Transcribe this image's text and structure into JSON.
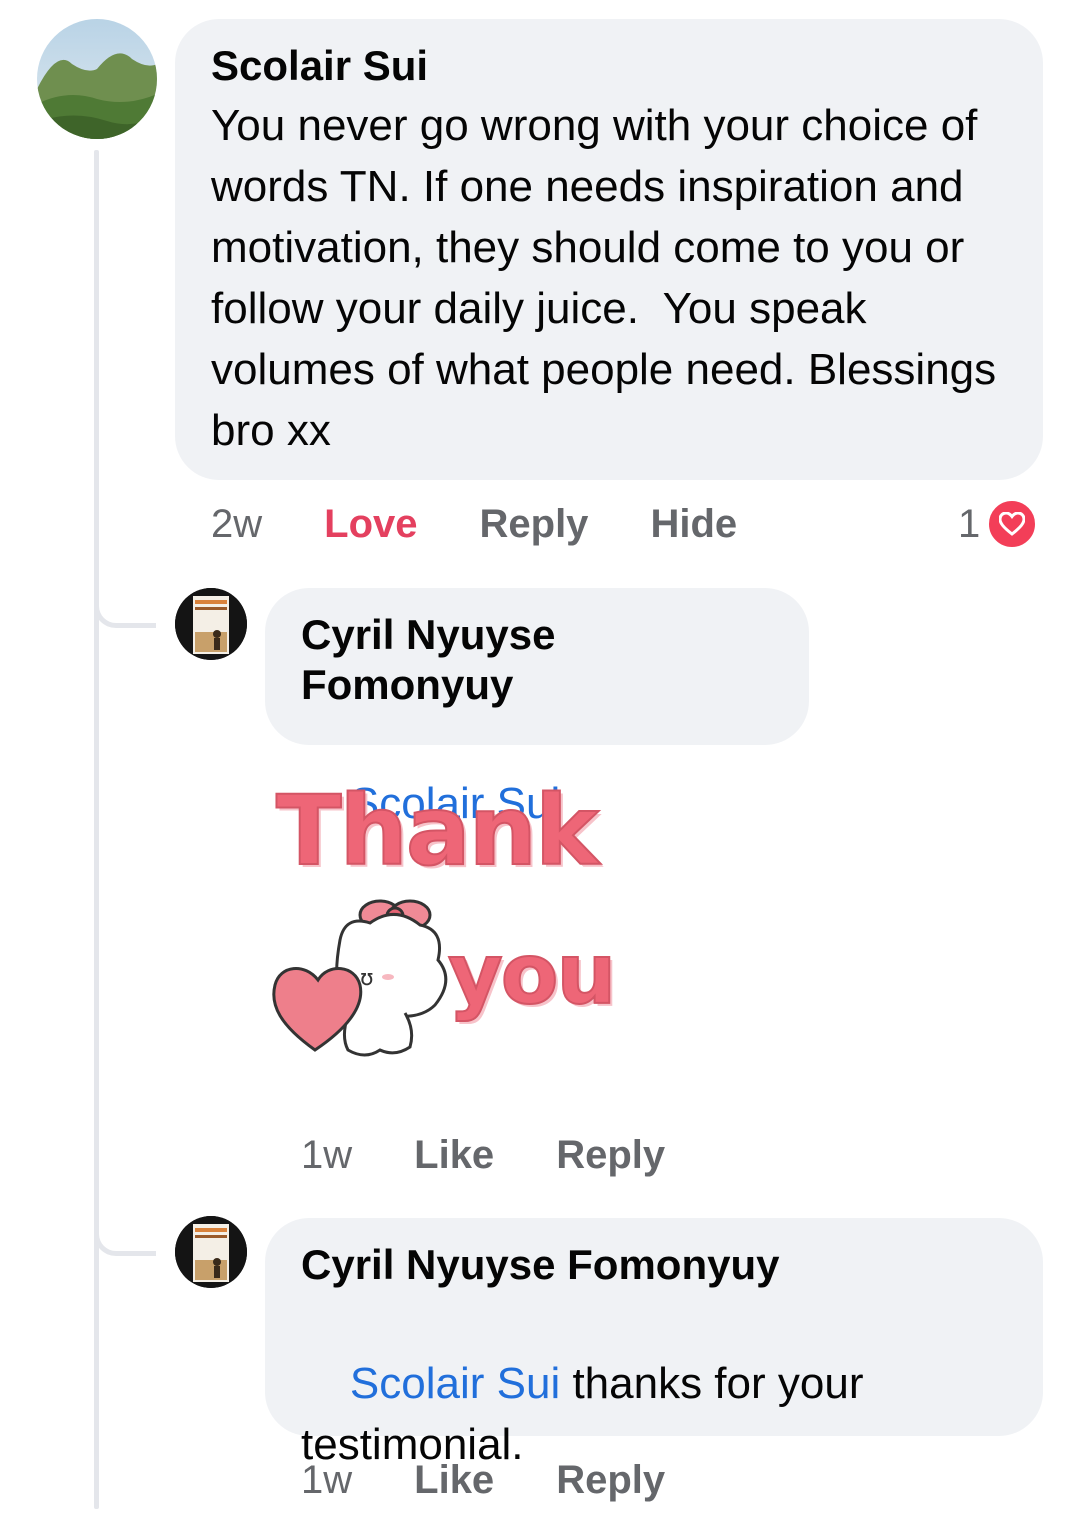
{
  "comment": {
    "author": "Scolair Sui",
    "text": "You never go wrong with your choice of words TN. If one needs inspiration and motivation, they should come to you or follow your daily juice.  You speak volumes of what people need. Blessings bro xx",
    "time": "2w",
    "actions": {
      "love": "Love",
      "reply": "Reply",
      "hide": "Hide"
    },
    "reaction_count": "1",
    "reaction_icon": "heart-icon"
  },
  "replies": [
    {
      "author": "Cyril Nyuyse Fomonyuy",
      "mention": "Scolair Sui",
      "text": "",
      "sticker": {
        "line1": "Thank",
        "line2": "you"
      },
      "time": "1w",
      "like": "Like",
      "reply": "Reply"
    },
    {
      "author": "Cyril Nyuyse Fomonyuy",
      "mention": "Scolair Sui",
      "text": " thanks for your testimonial.",
      "time": "1w",
      "like": "Like",
      "reply": "Reply"
    }
  ],
  "colors": {
    "bubble": "#f0f2f5",
    "mention": "#216fdb",
    "love": "#e4405f",
    "meta": "#65676b",
    "thread_line": "#e4e6eb"
  }
}
